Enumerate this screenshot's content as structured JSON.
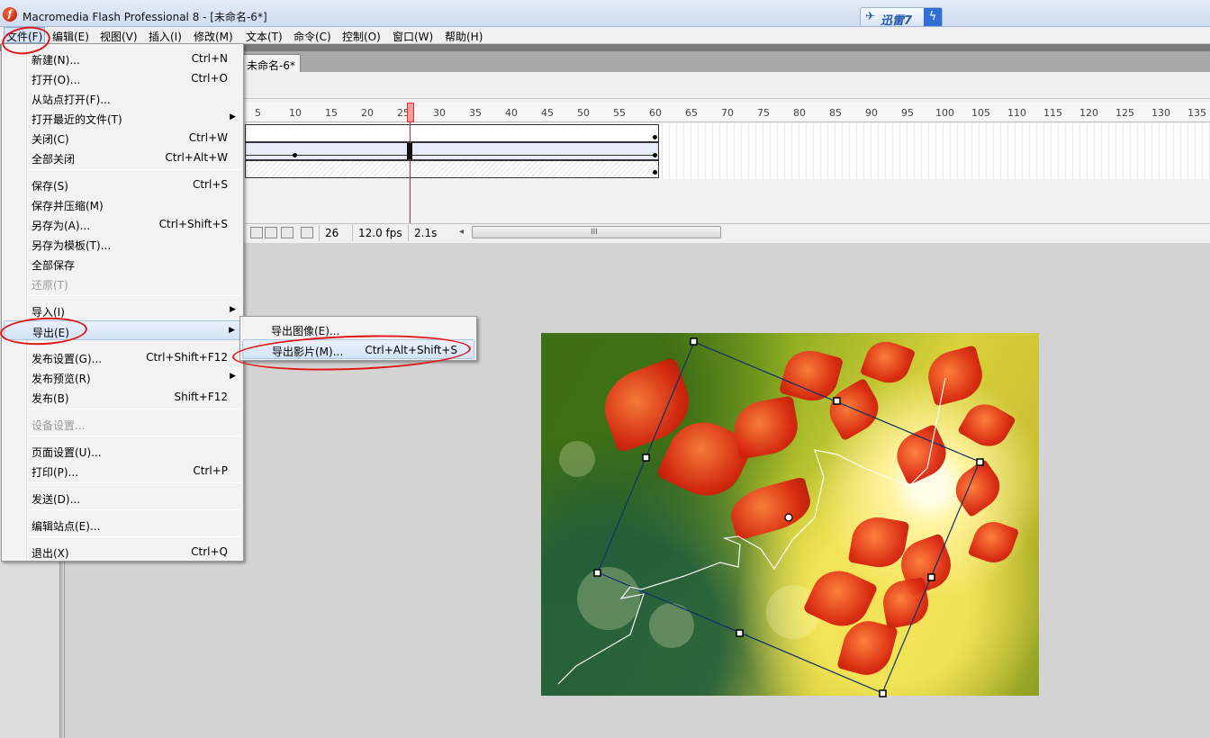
{
  "window": {
    "title": "Macromedia Flash Professional 8 - [未命名-6*]",
    "app_icon_glyph": "f",
    "thunder_badge": {
      "bird_glyph": "✈",
      "text": "迅雷7",
      "bolt_glyph": "ϟ"
    }
  },
  "menubar": {
    "items": [
      "文件(F)",
      "编辑(E)",
      "视图(V)",
      "插入(I)",
      "修改(M)",
      "文本(T)",
      "命令(C)",
      "控制(O)",
      "窗口(W)",
      "帮助(H)"
    ],
    "active": "文件(F)"
  },
  "document": {
    "tab_label": "未命名-6*"
  },
  "timeline": {
    "ruler_numbers": [
      "5",
      "10",
      "15",
      "20",
      "25",
      "30",
      "35",
      "40",
      "45",
      "50",
      "55",
      "60",
      "65",
      "70",
      "75",
      "80",
      "85",
      "90",
      "95",
      "100",
      "105",
      "110",
      "115",
      "120",
      "125",
      "130",
      "135"
    ],
    "current_frame": "26",
    "frame_rate": "12.0 fps",
    "elapsed_time": "2.1s",
    "scroll_arrow_glyph": "◂",
    "scroll_grip_glyph": "III"
  },
  "file_menu": {
    "items": [
      {
        "label": "新建(N)...",
        "shortcut": "Ctrl+N"
      },
      {
        "label": "打开(O)...",
        "shortcut": "Ctrl+O"
      },
      {
        "label": "从站点打开(F)...",
        "shortcut": ""
      },
      {
        "label": "打开最近的文件(T)",
        "shortcut": "",
        "submenu": true
      },
      {
        "label": "关闭(C)",
        "shortcut": "Ctrl+W"
      },
      {
        "label": "全部关闭",
        "shortcut": "Ctrl+Alt+W"
      },
      {
        "label": "保存(S)",
        "shortcut": "Ctrl+S"
      },
      {
        "label": "保存并压缩(M)",
        "shortcut": ""
      },
      {
        "label": "另存为(A)...",
        "shortcut": "Ctrl+Shift+S"
      },
      {
        "label": "另存为模板(T)...",
        "shortcut": ""
      },
      {
        "label": "全部保存",
        "shortcut": ""
      },
      {
        "label": "还原(T)",
        "shortcut": "",
        "disabled": true
      },
      {
        "label": "导入(I)",
        "shortcut": "",
        "submenu": true
      },
      {
        "label": "导出(E)",
        "shortcut": "",
        "submenu": true,
        "highlighted": true
      },
      {
        "label": "发布设置(G)...",
        "shortcut": "Ctrl+Shift+F12"
      },
      {
        "label": "发布预览(R)",
        "shortcut": "",
        "submenu": true
      },
      {
        "label": "发布(B)",
        "shortcut": "Shift+F12"
      },
      {
        "label": "设备设置...",
        "shortcut": "",
        "disabled": true
      },
      {
        "label": "页面设置(U)...",
        "shortcut": ""
      },
      {
        "label": "打印(P)...",
        "shortcut": "Ctrl+P"
      },
      {
        "label": "发送(D)...",
        "shortcut": ""
      },
      {
        "label": "编辑站点(E)...",
        "shortcut": ""
      },
      {
        "label": "退出(X)",
        "shortcut": "Ctrl+Q"
      }
    ],
    "submenu_arrow_glyph": "▶"
  },
  "export_submenu": {
    "items": [
      {
        "label": "导出图像(E)...",
        "shortcut": ""
      },
      {
        "label": "导出影片(M)...",
        "shortcut": "Ctrl+Alt+Shift+S",
        "highlighted": true
      }
    ]
  },
  "colors": {
    "annotation_red": "#e01616",
    "menu_highlight": "#d3e3f7",
    "playhead": "#d82020"
  }
}
